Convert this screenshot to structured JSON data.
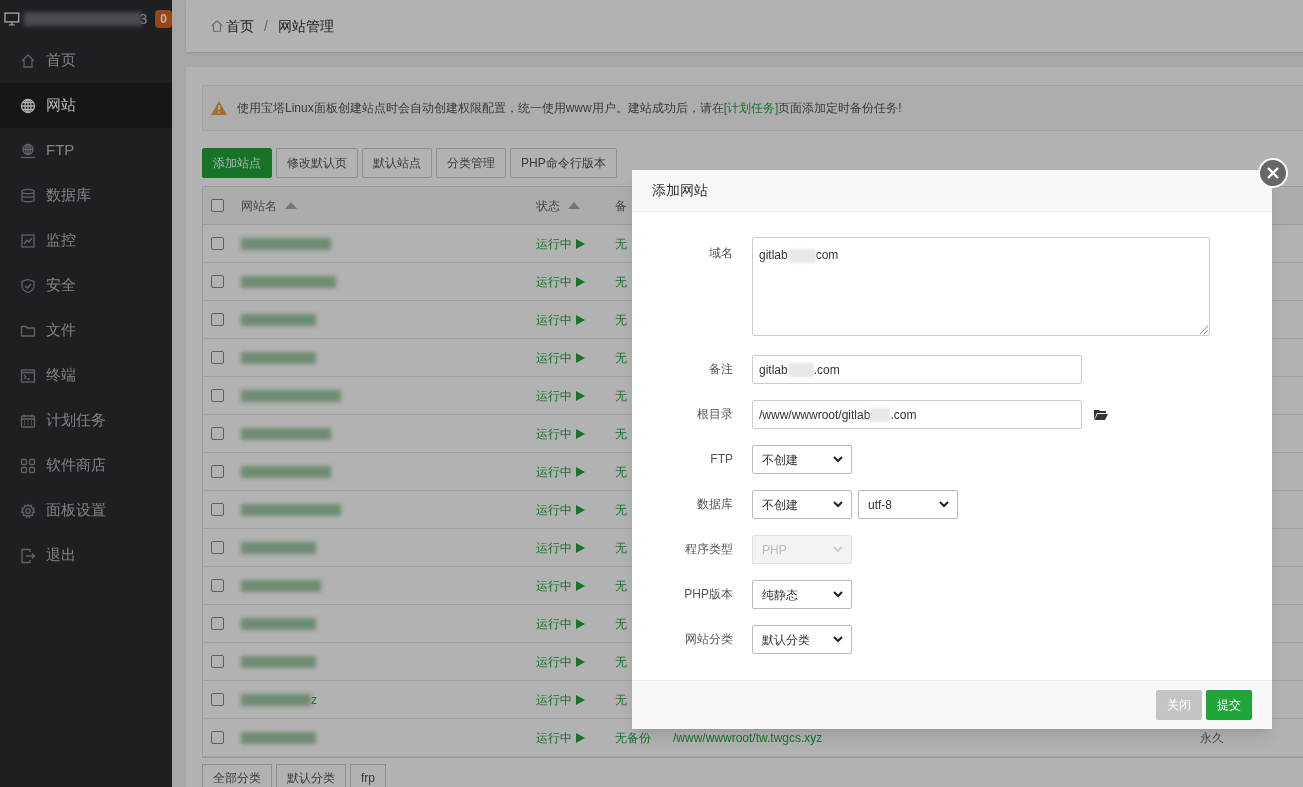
{
  "sidebar": {
    "host_suffix": "3",
    "badge": "0",
    "items": [
      {
        "label": "首页",
        "selected": false
      },
      {
        "label": "网站",
        "selected": true
      },
      {
        "label": "FTP",
        "selected": false
      },
      {
        "label": "数据库",
        "selected": false
      },
      {
        "label": "监控",
        "selected": false
      },
      {
        "label": "安全",
        "selected": false
      },
      {
        "label": "文件",
        "selected": false
      },
      {
        "label": "终端",
        "selected": false
      },
      {
        "label": "计划任务",
        "selected": false
      },
      {
        "label": "软件商店",
        "selected": false
      },
      {
        "label": "面板设置",
        "selected": false
      },
      {
        "label": "退出",
        "selected": false
      }
    ]
  },
  "breadcrumb": [
    "首页",
    "网站管理"
  ],
  "breadcrumb_separator": "/",
  "notice": {
    "before": "使用宝塔Linux面板创建站点时会自动创建权限配置，统一使用www用户。建站成功后，请在",
    "link": "[计划任务]",
    "after": "页面添加定时备份任务!"
  },
  "toolbar": [
    {
      "label": "添加站点",
      "primary": true
    },
    {
      "label": "修改默认页",
      "primary": false
    },
    {
      "label": "默认站点",
      "primary": false
    },
    {
      "label": "分类管理",
      "primary": false
    },
    {
      "label": "PHP命令行版本",
      "primary": false
    }
  ],
  "table": {
    "columns": [
      "网站名",
      "状态",
      "备"
    ],
    "all_checked": false,
    "rows": [
      {
        "checked": false,
        "status": "运行中",
        "backup": "无"
      },
      {
        "checked": false,
        "status": "运行中",
        "backup": "无"
      },
      {
        "checked": false,
        "status": "运行中",
        "backup": "无"
      },
      {
        "checked": false,
        "status": "运行中",
        "backup": "无"
      },
      {
        "checked": false,
        "status": "运行中",
        "backup": "无"
      },
      {
        "checked": false,
        "status": "运行中",
        "backup": "无"
      },
      {
        "checked": false,
        "status": "运行中",
        "backup": "无"
      },
      {
        "checked": false,
        "status": "运行中",
        "backup": "无"
      },
      {
        "checked": false,
        "status": "运行中",
        "backup": "无"
      },
      {
        "checked": false,
        "status": "运行中",
        "backup": "无"
      },
      {
        "checked": false,
        "status": "运行中",
        "backup": "无"
      },
      {
        "checked": false,
        "status": "运行中",
        "backup": "无"
      },
      {
        "checked": false,
        "name": "z",
        "status": "运行中",
        "backup": "无"
      },
      {
        "checked": false,
        "status": "运行中",
        "backup": "无备份",
        "path": "/www/wwwroot/tw.twgcs.xyz",
        "expiry": "永久"
      }
    ]
  },
  "category_tabs": [
    "全部分类",
    "默认分类",
    "frp"
  ],
  "dialog": {
    "title": "添加网站",
    "fields": [
      {
        "kind": "textarea",
        "label": "域名",
        "value_start": "gitlab",
        "value_end": "com"
      },
      {
        "kind": "input",
        "label": "备注",
        "value_start": "gitlab",
        "value_end": ".com"
      },
      {
        "kind": "path",
        "label": "根目录",
        "value_start": "/www/wwwroot/gitlab",
        "value_end": ".com"
      },
      {
        "kind": "select",
        "label": "FTP",
        "selects": [
          {
            "value": "不创建",
            "disabled": false
          }
        ]
      },
      {
        "kind": "select",
        "label": "数据库",
        "selects": [
          {
            "value": "不创建",
            "disabled": false
          },
          {
            "value": "utf-8",
            "disabled": false
          }
        ]
      },
      {
        "kind": "select",
        "label": "程序类型",
        "selects": [
          {
            "value": "PHP",
            "disabled": true
          }
        ]
      },
      {
        "kind": "select",
        "label": "PHP版本",
        "selects": [
          {
            "value": "纯静态",
            "disabled": false
          }
        ]
      },
      {
        "kind": "select",
        "label": "网站分类",
        "selects": [
          {
            "value": "默认分类",
            "disabled": false
          }
        ]
      }
    ],
    "buttons": [
      {
        "label": "关闭",
        "kind": "secondary"
      },
      {
        "label": "提交",
        "kind": "primary"
      }
    ]
  }
}
